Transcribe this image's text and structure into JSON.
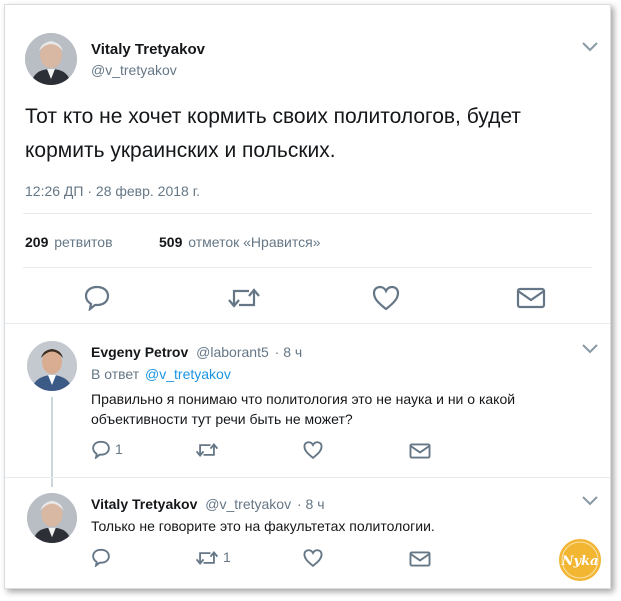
{
  "main_tweet": {
    "author_name": "Vitaly Tretyakov",
    "author_handle": "@v_tretyakov",
    "text_line1": "Тот кто не хочет кормить своих политологов, будет",
    "text_line2": "кормить украинских и польских.",
    "timestamp": "12:26 ДП · 28 февр. 2018 г.",
    "retweets_count": "209",
    "retweets_label": "ретвитов",
    "likes_count": "509",
    "likes_label": "отметок «Нравится»"
  },
  "reply1": {
    "author_name": "Evgeny Petrov",
    "author_handle": "@laborant5",
    "time": "· 8 ч",
    "reply_to_prefix": "В ответ",
    "reply_to_handle": "@v_tretyakov",
    "text_line1": "Правильно я понимаю что политология это не наука и ни о какой",
    "text_line2": "объективности тут речи быть не может?",
    "reply_count": "1"
  },
  "reply2": {
    "author_name": "Vitaly Tretyakov",
    "author_handle": "@v_tretyakov",
    "time": "· 8 ч",
    "text": "Только не говорите это на факультетах политологии.",
    "retweet_count": "1"
  },
  "watermark": {
    "text": "Nyka"
  },
  "colors": {
    "accent": "#1b95e0",
    "muted": "#657786",
    "icon": "#657786",
    "watermark": "#f2b632"
  }
}
